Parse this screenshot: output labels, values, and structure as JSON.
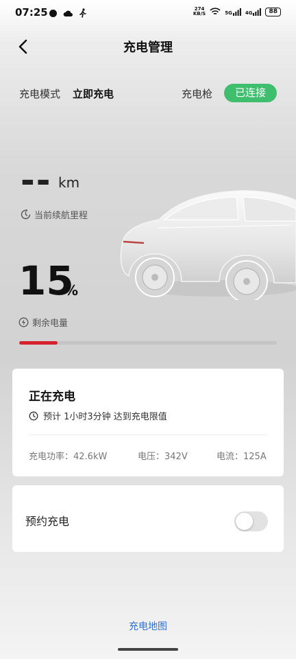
{
  "status_bar": {
    "time": "07:25",
    "net_speed": "274\nKB/S",
    "signal_1": "5G",
    "signal_2": "4G",
    "battery": "88"
  },
  "header": {
    "title": "充电管理",
    "back_icon": "chevron-left-icon"
  },
  "mode_row": {
    "mode_label": "充电模式",
    "mode_value": "立即充电",
    "gun_label": "充电枪",
    "gun_status": "已连接",
    "gun_status_color": "#3fbf6e"
  },
  "range": {
    "value": "--",
    "unit": "km",
    "caption": "当前续航里程"
  },
  "soc": {
    "value": "15",
    "unit": "%",
    "caption": "剩余电量",
    "fill_percent": 15,
    "fill_color": "#d6212c"
  },
  "charging_card": {
    "title": "正在充电",
    "eta": "预计 1小时3分钟 达到充电限值",
    "power": "充电功率：42.6kW",
    "voltage": "电压：342V",
    "current": "电流：125A"
  },
  "reserve_card": {
    "label": "预约充电",
    "toggle_on": false
  },
  "footer": {
    "map_link": "充电地图",
    "link_color": "#2f6fd6"
  }
}
